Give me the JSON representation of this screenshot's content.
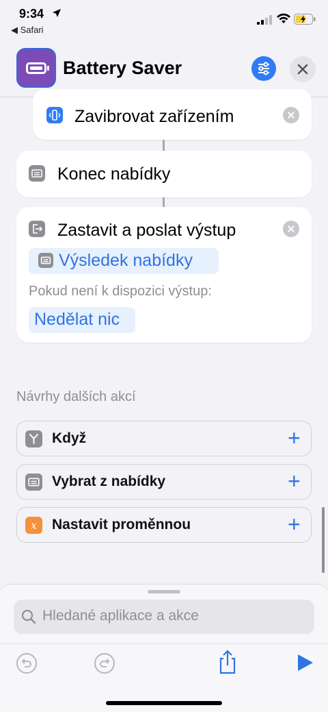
{
  "status_bar": {
    "time": "9:34",
    "back_app": "Safari"
  },
  "header": {
    "title": "Battery Saver"
  },
  "actions": [
    {
      "label": "Zavibrovat zařízením"
    },
    {
      "label": "Konec nabídky"
    },
    {
      "label": "Zastavit a poslat výstup",
      "token": "Výsledek nabídky",
      "fallback_label": "Pokud není k dispozici výstup:",
      "fallback_value": "Nedělat nic"
    }
  ],
  "suggestions": {
    "title": "Návrhy dalších akcí",
    "items": [
      {
        "label": "Když",
        "color": "#8e8e93"
      },
      {
        "label": "Vybrat z nabídky",
        "color": "#8e8e93"
      },
      {
        "label": "Nastavit proměnnou",
        "color": "#f5913a"
      }
    ]
  },
  "search": {
    "placeholder": "Hledané aplikace a akce"
  },
  "colors": {
    "accent": "#2f74e2",
    "app_icon": "#7b4bb8"
  }
}
